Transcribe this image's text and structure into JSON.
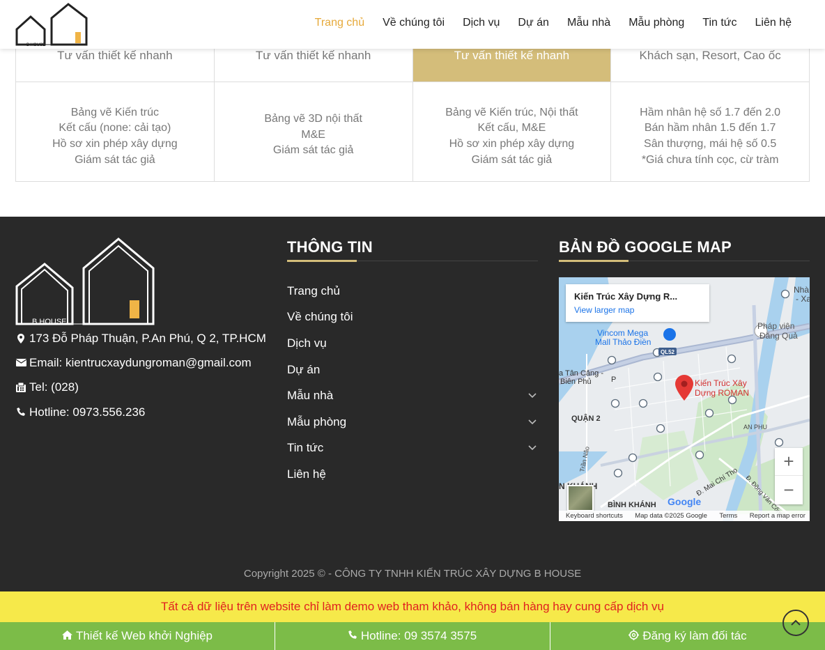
{
  "header": {
    "nav": [
      "Trang chủ",
      "Về chúng tôi",
      "Dịch vụ",
      "Dự án",
      "Mẫu nhà",
      "Mẫu phòng",
      "Tin tức",
      "Liên hệ"
    ],
    "logo_text": "B HOUSE"
  },
  "pricing": {
    "columns": [
      {
        "title": "Tư vấn thiết kế nhanh",
        "items": [
          "Bảng vẽ Kiến trúc",
          "Kết cấu (none: cải tạo)",
          "Hồ sơ xin phép xây dựng",
          "Giám sát tác giả"
        ]
      },
      {
        "title": "Tư vấn thiết kế nhanh",
        "items": [
          "Bảng vẽ 3D nội thất",
          "M&E",
          "Giám sát tác giả"
        ]
      },
      {
        "title": "Tư vấn thiết kế nhanh",
        "items": [
          "Bảng vẽ Kiến trúc, Nội thất",
          "Kết cấu, M&E",
          "Hồ sơ xin phép xây dựng",
          "Giám sát tác giả"
        ]
      },
      {
        "title": "Khách sạn, Resort, Cao ốc",
        "items": [
          "Hầm nhân hệ số 1.7 đến 2.0",
          "Bán hầm nhân 1.5 đến 1.7",
          "Sân thượng, mái hệ số 0.5",
          "*Giá chưa tính cọc, cừ tràm"
        ]
      }
    ]
  },
  "footer": {
    "address": "173 Đỗ Pháp Thuận, P.An Phú, Q 2, TP.HCM",
    "email": "Email: kientrucxaydungroman@gmail.com",
    "tel": "Tel: (028)",
    "hotline": "Hotline: 0973.556.236",
    "info_title": "THÔNG TIN",
    "map_title": "BẢN ĐỒ GOOGLE MAP",
    "links": [
      {
        "label": "Trang chủ",
        "has_sub": false
      },
      {
        "label": "Về chúng tôi",
        "has_sub": false
      },
      {
        "label": "Dịch vụ",
        "has_sub": false
      },
      {
        "label": "Dự án",
        "has_sub": false
      },
      {
        "label": "Mẫu nhà",
        "has_sub": true
      },
      {
        "label": "Mẫu phòng",
        "has_sub": true
      },
      {
        "label": "Tin tức",
        "has_sub": true
      },
      {
        "label": "Liên hệ",
        "has_sub": false
      }
    ],
    "copyright": "Copyright 2025 © - CÔNG TY TNHH KIẾN TRÚC XÂY DỰNG B HOUSE"
  },
  "map": {
    "place_name": "Kiến Trúc Xây Dựng R...",
    "view_larger": "View larger map",
    "pin_label_1": "Kiến Trúc Xây",
    "pin_label_2": "Dựng ROMAN",
    "labels": {
      "vincom1": "Vincom Mega",
      "vincom2": "Mall Thảo Điền",
      "ql52": "QL52",
      "tancang1": "a Tân Cảng -",
      "tancang2": "Biên Phủ",
      "quan2": "QUẬN 2",
      "anphu": "AN PHU",
      "trannao": "Trần Não",
      "binhkhanh": "BÌNH KHÁNH",
      "nkhanh": "N KHÁNH",
      "maichitho": "Đ. Mai Chí Thọ",
      "dongvan": "Đ. Đồng Văn Cống",
      "phapvien1": "Pháp viện",
      "phapvien2": "Đăng Quả",
      "nha1": "Nhà",
      "nha2": "- Xa",
      "p": "P"
    },
    "zoom_in": "+",
    "zoom_out": "−",
    "google": "Google",
    "attrib": [
      "Keyboard shortcuts",
      "Map data ©2025 Google",
      "Terms",
      "Report a map error"
    ]
  },
  "notice": "Tất cả dữ liệu trên website chỉ làm demo web tham khảo, không bán hàng hay cung cấp dịch vụ",
  "bottombar": {
    "startup": "Thiết kế Web khởi Nghiệp",
    "hotline": "Hotline: 09 3574 3575",
    "partner": "Đăng ký làm đối tác"
  },
  "colors": {
    "accent": "#e6a93a",
    "gold": "#d4bd7a",
    "footer_bg": "#292929",
    "notice_bg": "#f6e94a",
    "notice_text": "#e0201f",
    "bar_bg": "#7cbc48"
  },
  "icons": {
    "address": "map-marker-icon",
    "email": "envelope-icon",
    "tel": "fax-icon",
    "hotline": "phone-icon",
    "startup": "home-icon",
    "bar_hotline": "phone-icon",
    "partner": "gear-icon",
    "top": "chevron-up-icon"
  }
}
